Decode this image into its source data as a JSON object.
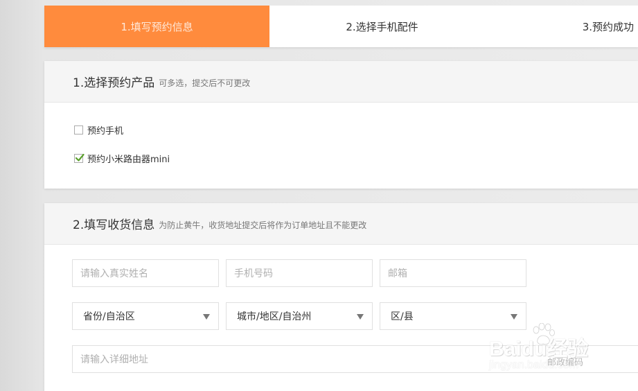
{
  "steps": [
    {
      "label": "1.填写预约信息",
      "active": true
    },
    {
      "label": "2.选择手机配件",
      "active": false
    },
    {
      "label": "3.预约成功",
      "active": false
    }
  ],
  "colors": {
    "accent": "#ff8b3d",
    "check": "#5aa02c"
  },
  "section1": {
    "title": "1.选择预约产品",
    "hint": "可多选，提交后不可更改",
    "options": [
      {
        "label": "预约手机",
        "checked": false
      },
      {
        "label": "预约小米路由器mini",
        "checked": true
      }
    ]
  },
  "section2": {
    "title": "2.填写收货信息",
    "hint": "为防止黄牛，收货地址提交后将作为订单地址且不能更改",
    "fields": {
      "name_placeholder": "请输入真实姓名",
      "phone_placeholder": "手机号码",
      "email_placeholder": "邮箱",
      "province": "省份/自治区",
      "city": "城市/地区/自治州",
      "district": "区/县",
      "address_placeholder": "请输入详细地址",
      "postal_placeholder": "邮政编码"
    }
  },
  "watermark": {
    "brand": "Baidu经验",
    "url": "jingyan.baidu.com",
    "icon": "baidu-paw-icon"
  }
}
